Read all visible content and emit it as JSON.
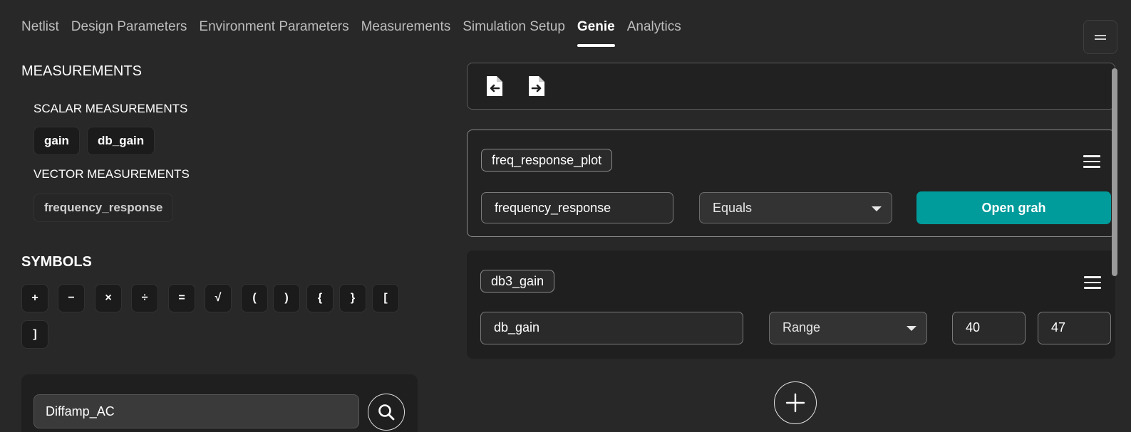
{
  "tabs": [
    {
      "label": "Netlist"
    },
    {
      "label": "Design Parameters"
    },
    {
      "label": "Environment Parameters"
    },
    {
      "label": "Measurements"
    },
    {
      "label": "Simulation Setup"
    },
    {
      "label": "Genie",
      "active": true
    },
    {
      "label": "Analytics"
    }
  ],
  "left": {
    "measurements_title": "MEASUREMENTS",
    "scalar_title": "SCALAR MEASUREMENTS",
    "scalar_items": [
      "gain",
      "db_gain"
    ],
    "vector_title": "VECTOR MEASUREMENTS",
    "vector_items": [
      "frequency_response"
    ],
    "symbols_title": "SYMBOLS",
    "symbols": [
      "+",
      "−",
      "×",
      "÷",
      "=",
      "√",
      "(",
      ")",
      "{",
      "}",
      "[",
      "]"
    ],
    "search": {
      "value": "Diffamp_AC"
    }
  },
  "right": {
    "conditions": [
      {
        "name": "freq_response_plot",
        "measurement": "frequency_response",
        "operator": "Equals",
        "action_label": "Open grah"
      },
      {
        "name": "db3_gain",
        "measurement": "db_gain",
        "operator": "Range",
        "min": "40",
        "max": "47"
      }
    ]
  },
  "colors": {
    "accent": "#009b9b",
    "background": "#282828",
    "card": "#1f1f1f"
  }
}
